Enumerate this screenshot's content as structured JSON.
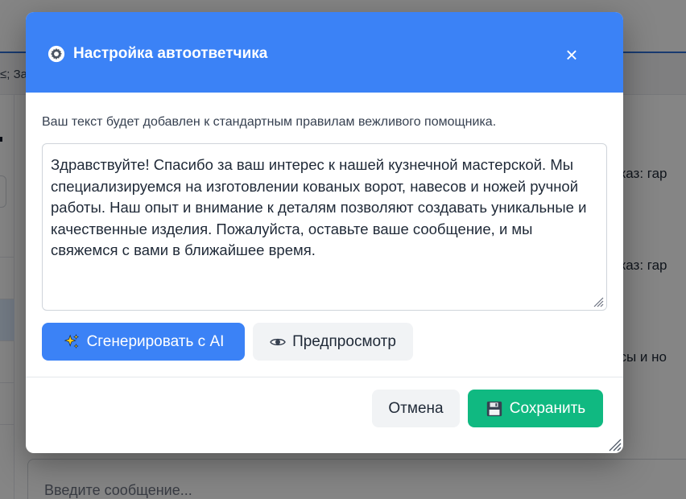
{
  "background": {
    "breadcrumb_fragment": "≤; Зак",
    "chat_snippets": [
      "аказ: гар",
      "аказ: гар",
      "есы и но"
    ],
    "message_input_placeholder": "Введите сообщение..."
  },
  "modal": {
    "title": "Настройка автоответчика",
    "title_icon": "gear-icon",
    "close_label": "×",
    "description": "Ваш текст будет добавлен к стандартным правилам вежливого помощника.",
    "autoreply_text": "Здравствуйте! Спасибо за ваш интерес к нашей кузнечной мастерской. Мы специализируемся на изготовлении кованых ворот, навесов и ножей ручной работы. Наш опыт и внимание к деталям позволяют создавать уникальные и качественные изделия. Пожалуйста, оставьте ваше сообщение, и мы свяжемся с вами в ближайшее время.",
    "generate_button": {
      "label": "Сгенерировать с AI",
      "icon": "sparkles-icon"
    },
    "preview_button": {
      "label": "Предпросмотр",
      "icon": "eye-icon"
    },
    "cancel_button": {
      "label": "Отмена"
    },
    "save_button": {
      "label": "Сохранить",
      "icon": "floppy-disk-icon"
    }
  },
  "colors": {
    "header_blue": "#3b82f6",
    "save_green": "#10b981",
    "secondary_gray": "#f1f3f5"
  }
}
